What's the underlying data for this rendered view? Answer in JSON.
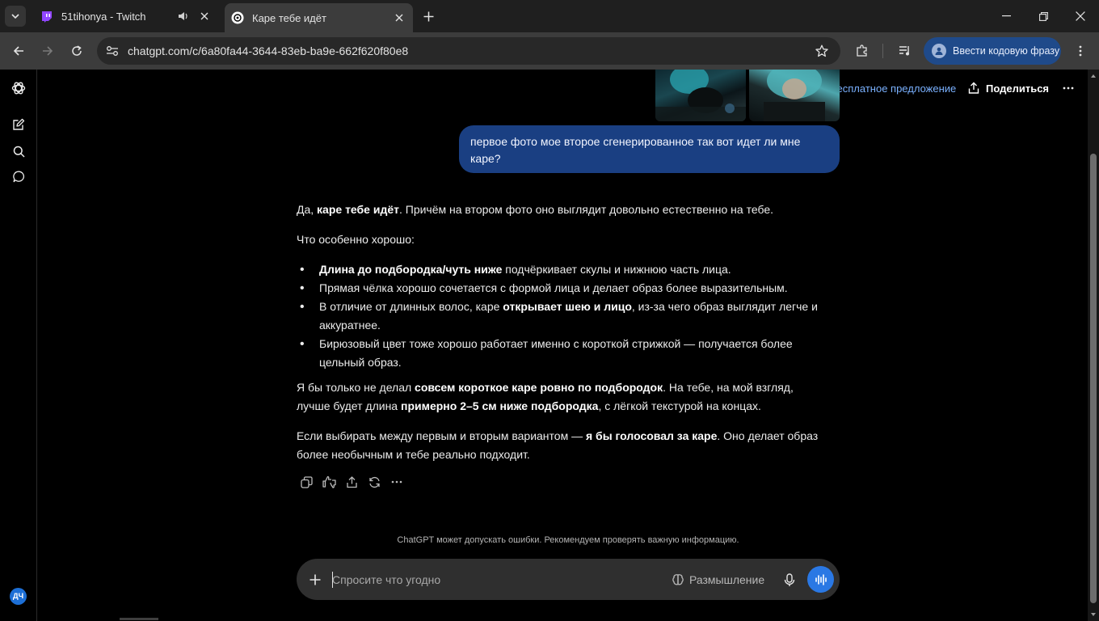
{
  "browser": {
    "tabs": [
      {
        "title": "51tihonya - Twitch",
        "active": false,
        "favicon": "twitch-icon",
        "audio": true
      },
      {
        "title": "Каре тебе идёт",
        "active": true,
        "favicon": "openai-icon",
        "audio": false
      }
    ],
    "url": "chatgpt.com/c/6a80fa44-3644-83eb-ba9e-662f620f80e8",
    "profile_label": "Ввести кодовую фразу"
  },
  "header": {
    "offer_label": "Бесплатное предложение",
    "share_label": "Поделиться"
  },
  "user_message": "первое фото мое второе сгенерированное так вот идет ли мне каре?",
  "assistant": {
    "p1_pre": "Да, ",
    "p1_bold": "каре тебе идёт",
    "p1_post": ". Причём на втором фото оно выглядит довольно естественно на тебе.",
    "p2": "Что особенно хорошо:",
    "bullets": [
      {
        "bold": "Длина до подбородка/чуть ниже",
        "text": " подчёркивает скулы и нижнюю часть лица."
      },
      {
        "text": "Прямая чёлка хорошо сочетается с формой лица и делает образ более выразительным."
      },
      {
        "pre": "В отличие от длинных волос, каре ",
        "bold": "открывает шею и лицо",
        "text": ", из-за чего образ выглядит легче и аккуратнее."
      },
      {
        "text": "Бирюзовый цвет тоже хорошо работает именно с короткой стрижкой — получается более цельный образ."
      }
    ],
    "p3_pre": "Я бы только не делал ",
    "p3_bold1": "совсем короткое каре ровно по подбородок",
    "p3_mid": ". На тебе, на мой взгляд, лучше будет длина ",
    "p3_bold2": "примерно 2–5 см ниже подбородка",
    "p3_post": ", с лёгкой текстурой на концах.",
    "p4_pre": "Если выбирать между первым и вторым вариантом — ",
    "p4_bold": "я бы голосовал за каре",
    "p4_post": ". Оно делает образ более необычным и тебе реально подходит."
  },
  "disclaimer": "ChatGPT может допускать ошибки. Рекомендуем проверять важную информацию.",
  "composer": {
    "placeholder": "Спросите что угодно",
    "reasoning_label": "Размышление"
  },
  "user": {
    "initials": "ДЧ"
  },
  "colors": {
    "accent": "#2a78e4",
    "user_bubble": "#1a3f82",
    "offer_link": "#7ab1ff"
  }
}
